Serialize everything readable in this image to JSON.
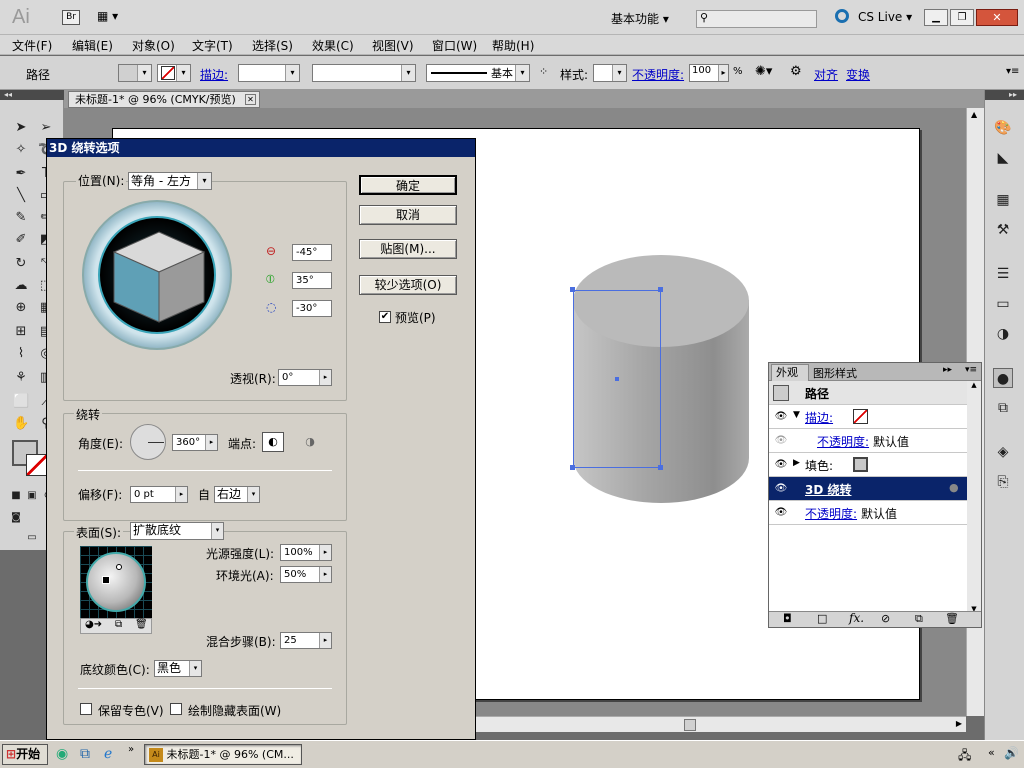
{
  "app": {
    "logo": "Ai",
    "bridge": "Br",
    "workspace": "基本功能",
    "cslive": "CS Live"
  },
  "menu": [
    "文件(F)",
    "编辑(E)",
    "对象(O)",
    "文字(T)",
    "选择(S)",
    "效果(C)",
    "视图(V)",
    "窗口(W)",
    "帮助(H)"
  ],
  "control": {
    "path_label": "路径",
    "stroke_label": "描边:",
    "stroke_profile": "基本",
    "style_label": "样式:",
    "opacity_label": "不透明度:",
    "opacity_value": "100",
    "percent": "%",
    "align": "对齐",
    "transform": "变换"
  },
  "doc_tab": "未标题-1* @ 96% (CMYK/预览)",
  "dialog": {
    "title": "3D 绕转选项",
    "position_label": "位置(N):",
    "position_value": "等角 - 左方",
    "rot_x": "-45°",
    "rot_y": "35°",
    "rot_z": "-30°",
    "perspective_label": "透视(R):",
    "perspective_value": "0°",
    "revolve_group": "绕转",
    "angle_label": "角度(E):",
    "angle_value": "360°",
    "cap_label": "端点:",
    "offset_label": "偏移(F):",
    "offset_value": "0 pt",
    "from_label": "自",
    "from_value": "右边",
    "surface_label": "表面(S):",
    "surface_value": "扩散底纹",
    "light_intensity_label": "光源强度(L):",
    "light_intensity_value": "100%",
    "ambient_label": "环境光(A):",
    "ambient_value": "50%",
    "blend_steps_label": "混合步骤(B):",
    "blend_steps_value": "25",
    "shading_color_label": "底纹颜色(C):",
    "shading_color_value": "黑色",
    "preserve_spot": "保留专色(V)",
    "draw_hidden": "绘制隐藏表面(W)",
    "ok": "确定",
    "cancel": "取消",
    "map_art": "贴图(M)...",
    "fewer_options": "较少选项(O)",
    "preview": "预览(P)"
  },
  "appearance": {
    "tab1": "外观",
    "tab2": "图形样式",
    "title": "路径",
    "stroke": "描边:",
    "opacity_label": "不透明度:",
    "opacity_default": "默认值",
    "fill": "填色:",
    "effect": "3D 绕转",
    "opacity2": "不透明度:",
    "opacity2_default": "默认值",
    "fx": "fx."
  },
  "taskbar": {
    "start": "开始",
    "item": "未标题-1* @ 96% (CM..."
  },
  "colors": {
    "accent": "#0a246a",
    "selection": "#4a6ee0"
  }
}
